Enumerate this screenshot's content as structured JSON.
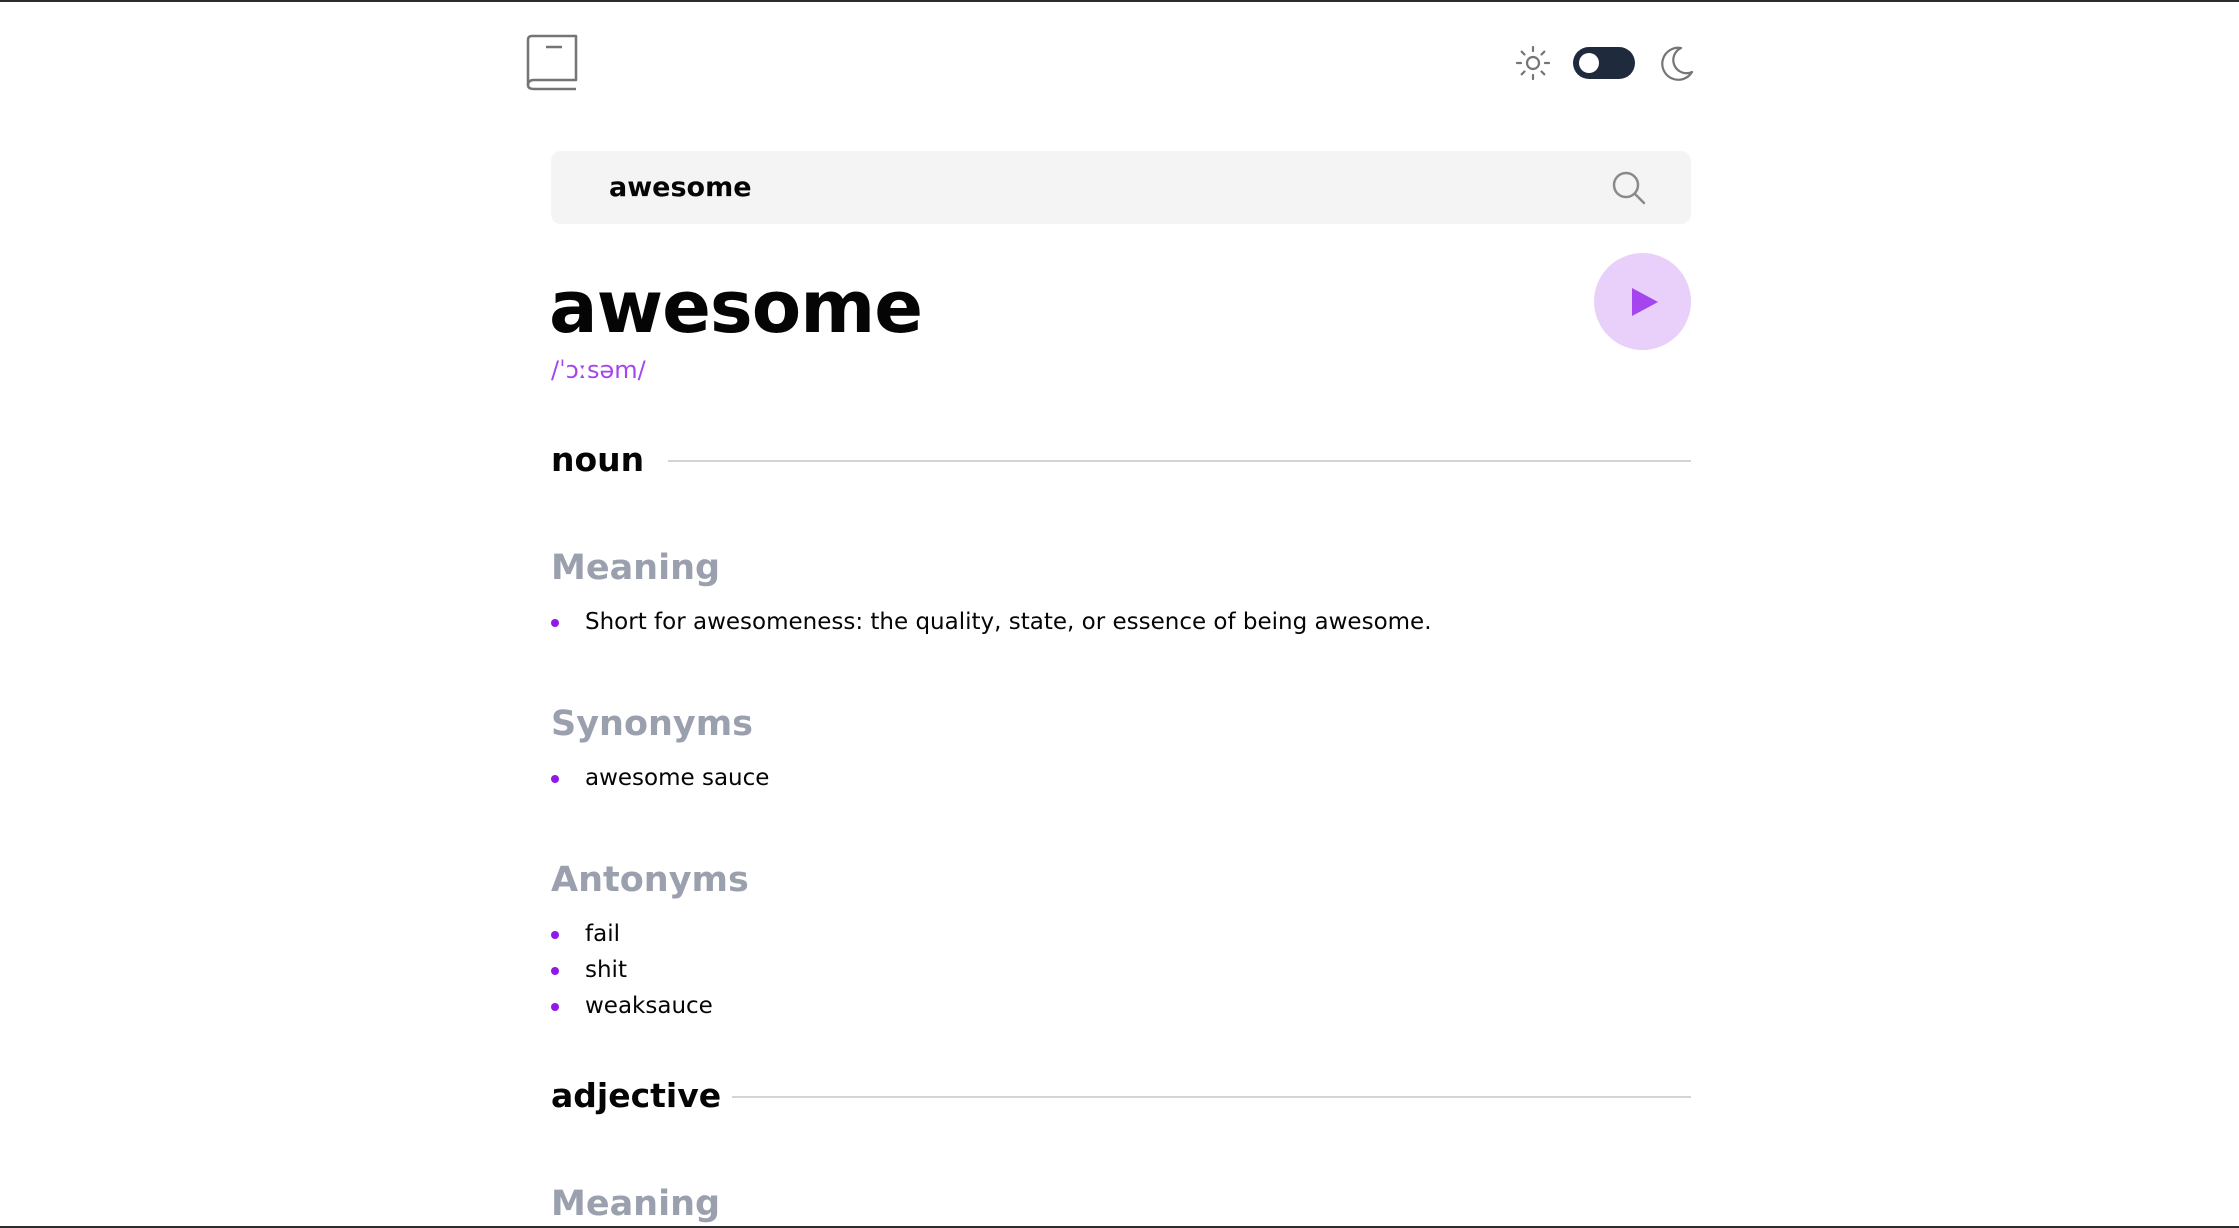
{
  "search": {
    "value": "awesome"
  },
  "word": {
    "title": "awesome",
    "phonetic": "/ˈɔːsəm/"
  },
  "theme": {
    "mode": "dark-toggle",
    "accent": "#a445ed",
    "bullet_color": "#8f19e8"
  },
  "icons": {
    "logo": "book-icon",
    "sun": "sun-icon",
    "moon": "moon-icon",
    "search": "search-icon",
    "play": "play-icon"
  },
  "noun": {
    "label": "noun",
    "meaning_heading": "Meaning",
    "meanings": [
      "Short for awesomeness: the quality, state, or essence of being awesome."
    ],
    "synonyms_heading": "Synonyms",
    "synonyms": [
      "awesome sauce"
    ],
    "antonyms_heading": "Antonyms",
    "antonyms": [
      "fail",
      "shit",
      "weaksauce"
    ]
  },
  "adjective": {
    "label": "adjective",
    "meaning_heading": "Meaning"
  }
}
